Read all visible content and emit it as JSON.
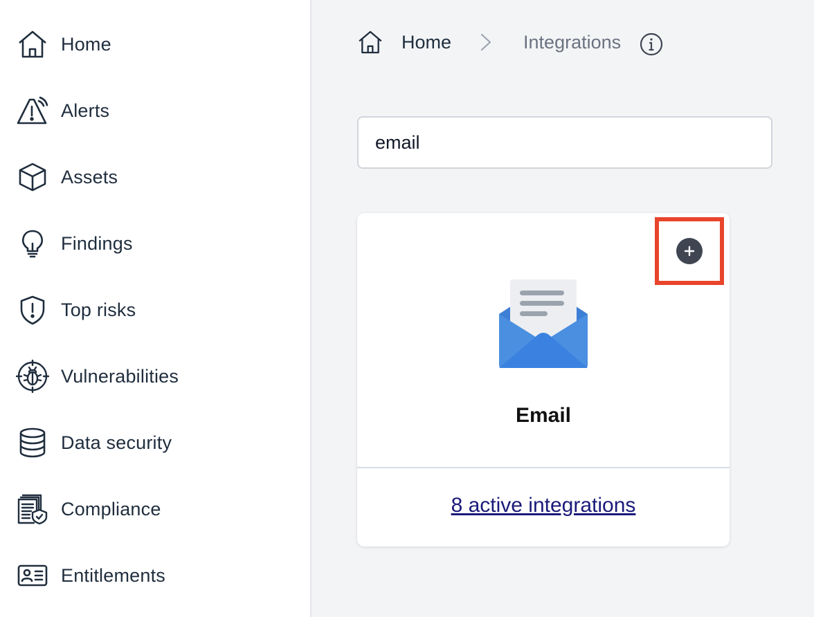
{
  "sidebar": {
    "items": [
      {
        "label": "Home",
        "icon": "home-icon"
      },
      {
        "label": "Alerts",
        "icon": "alert-triangle-icon"
      },
      {
        "label": "Assets",
        "icon": "cube-icon"
      },
      {
        "label": "Findings",
        "icon": "lightbulb-icon"
      },
      {
        "label": "Top risks",
        "icon": "shield-exclamation-icon"
      },
      {
        "label": "Vulnerabilities",
        "icon": "bug-target-icon"
      },
      {
        "label": "Data security",
        "icon": "database-icon"
      },
      {
        "label": "Compliance",
        "icon": "document-shield-icon"
      },
      {
        "label": "Entitlements",
        "icon": "id-card-icon"
      }
    ]
  },
  "breadcrumb": {
    "home_label": "Home",
    "current_label": "Integrations"
  },
  "search": {
    "value": "email"
  },
  "card": {
    "title": "Email",
    "link_text": "8 active integrations",
    "add_icon": "plus-circle-icon",
    "logo_icon": "email-envelope-icon"
  },
  "colors": {
    "highlight": "#e8452c",
    "envelope": "#4a8fe0",
    "link": "#1a1a7a"
  }
}
